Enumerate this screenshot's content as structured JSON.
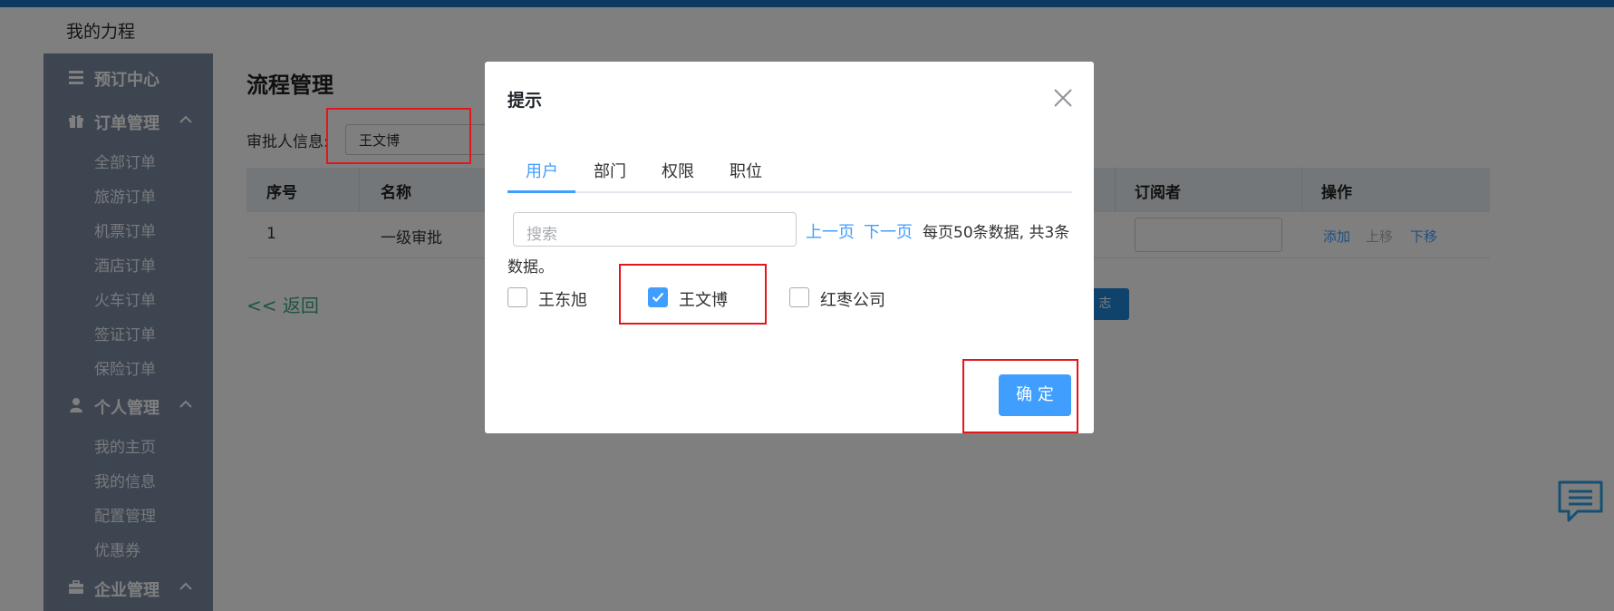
{
  "app": {
    "brand": "我的力程"
  },
  "sidebar": {
    "sections": [
      {
        "label": "预订中心",
        "icon": "list-icon"
      },
      {
        "label": "订单管理",
        "icon": "gift-icon",
        "items": [
          "全部订单",
          "旅游订单",
          "机票订单",
          "酒店订单",
          "火车订单",
          "签证订单",
          "保险订单"
        ]
      },
      {
        "label": "个人管理",
        "icon": "user-icon",
        "items": [
          "我的主页",
          "我的信息",
          "配置管理",
          "优惠券"
        ]
      },
      {
        "label": "企业管理",
        "icon": "briefcase-icon"
      }
    ]
  },
  "main": {
    "title": "流程管理",
    "approver_label": "审批人信息:",
    "approver_value": "王文博",
    "table": {
      "headers": [
        "序号",
        "名称",
        "订阅者",
        "操作"
      ],
      "rows": [
        {
          "index": "1",
          "name": "一级审批"
        }
      ],
      "actions": [
        "添加",
        "上移",
        "下移"
      ]
    },
    "back_label": "<< 返回",
    "behind_button_label": "志"
  },
  "dialog": {
    "title": "提示",
    "tabs": [
      "用户",
      "部门",
      "权限",
      "职位"
    ],
    "active_tab": "用户",
    "search_placeholder": "搜索",
    "prev_label": "上一页",
    "next_label": "下一页",
    "page_info_line1": "每页50条数据, 共3条",
    "page_info_line2": "数据。",
    "users": [
      {
        "name": "王东旭",
        "checked": false
      },
      {
        "name": "王文博",
        "checked": true
      },
      {
        "name": "红枣公司",
        "checked": false
      }
    ],
    "confirm_label": "确 定"
  },
  "colors": {
    "accent": "#409eff",
    "sidebar": "#7a8aa3",
    "highlight": "#e3161c",
    "topbar": "#1b75c4"
  }
}
